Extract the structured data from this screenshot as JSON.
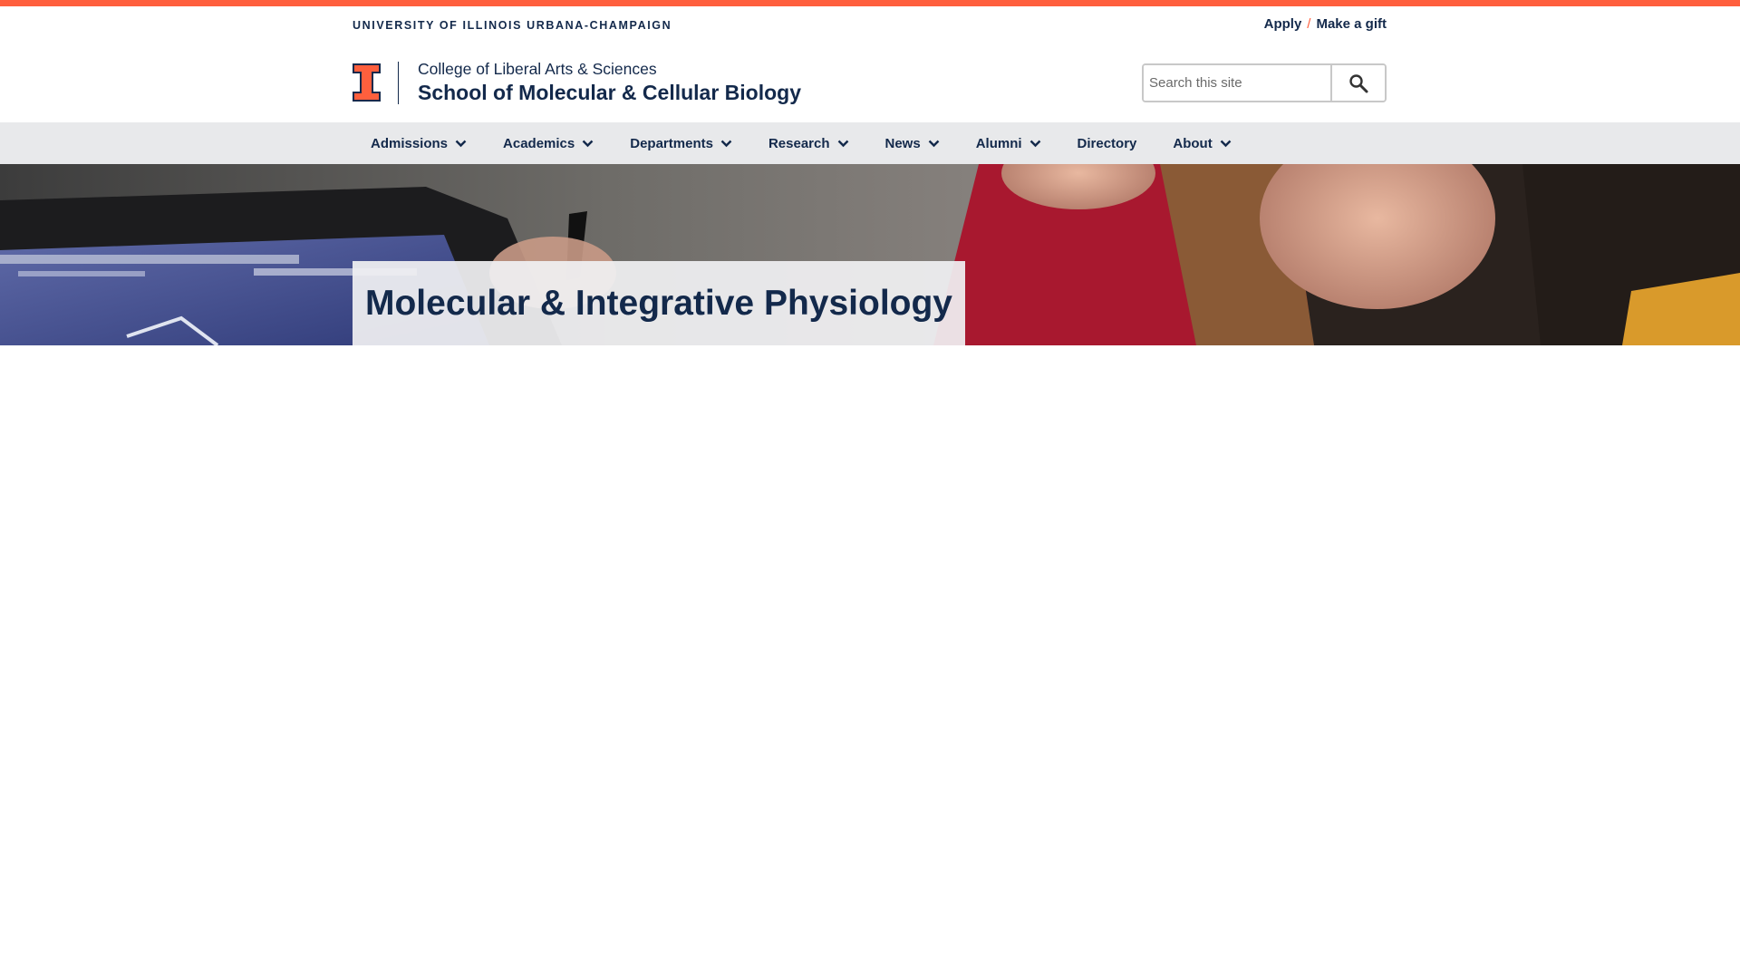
{
  "utility": {
    "university": "UNIVERSITY OF ILLINOIS URBANA-CHAMPAIGN",
    "apply": "Apply",
    "separator": "/",
    "make_gift": "Make a gift"
  },
  "header": {
    "college": "College of Liberal Arts & Sciences",
    "site_title": "School of Molecular & Cellular Biology",
    "search_placeholder": "Search this site"
  },
  "nav": {
    "items": [
      {
        "label": "Admissions",
        "dropdown": true
      },
      {
        "label": "Academics",
        "dropdown": true
      },
      {
        "label": "Departments",
        "dropdown": true
      },
      {
        "label": "Research",
        "dropdown": true
      },
      {
        "label": "News",
        "dropdown": true
      },
      {
        "label": "Alumni",
        "dropdown": true
      },
      {
        "label": "Directory",
        "dropdown": false
      },
      {
        "label": "About",
        "dropdown": true
      }
    ]
  },
  "hero": {
    "title": "Molecular & Integrative Physiology"
  },
  "colors": {
    "accent_orange": "#ff5f3d",
    "navy": "#13294b",
    "nav_bg": "#e8e9eb"
  },
  "icons": {
    "logo": "block-i-logo",
    "search": "search-icon",
    "dropdown": "chevron-down-icon"
  }
}
